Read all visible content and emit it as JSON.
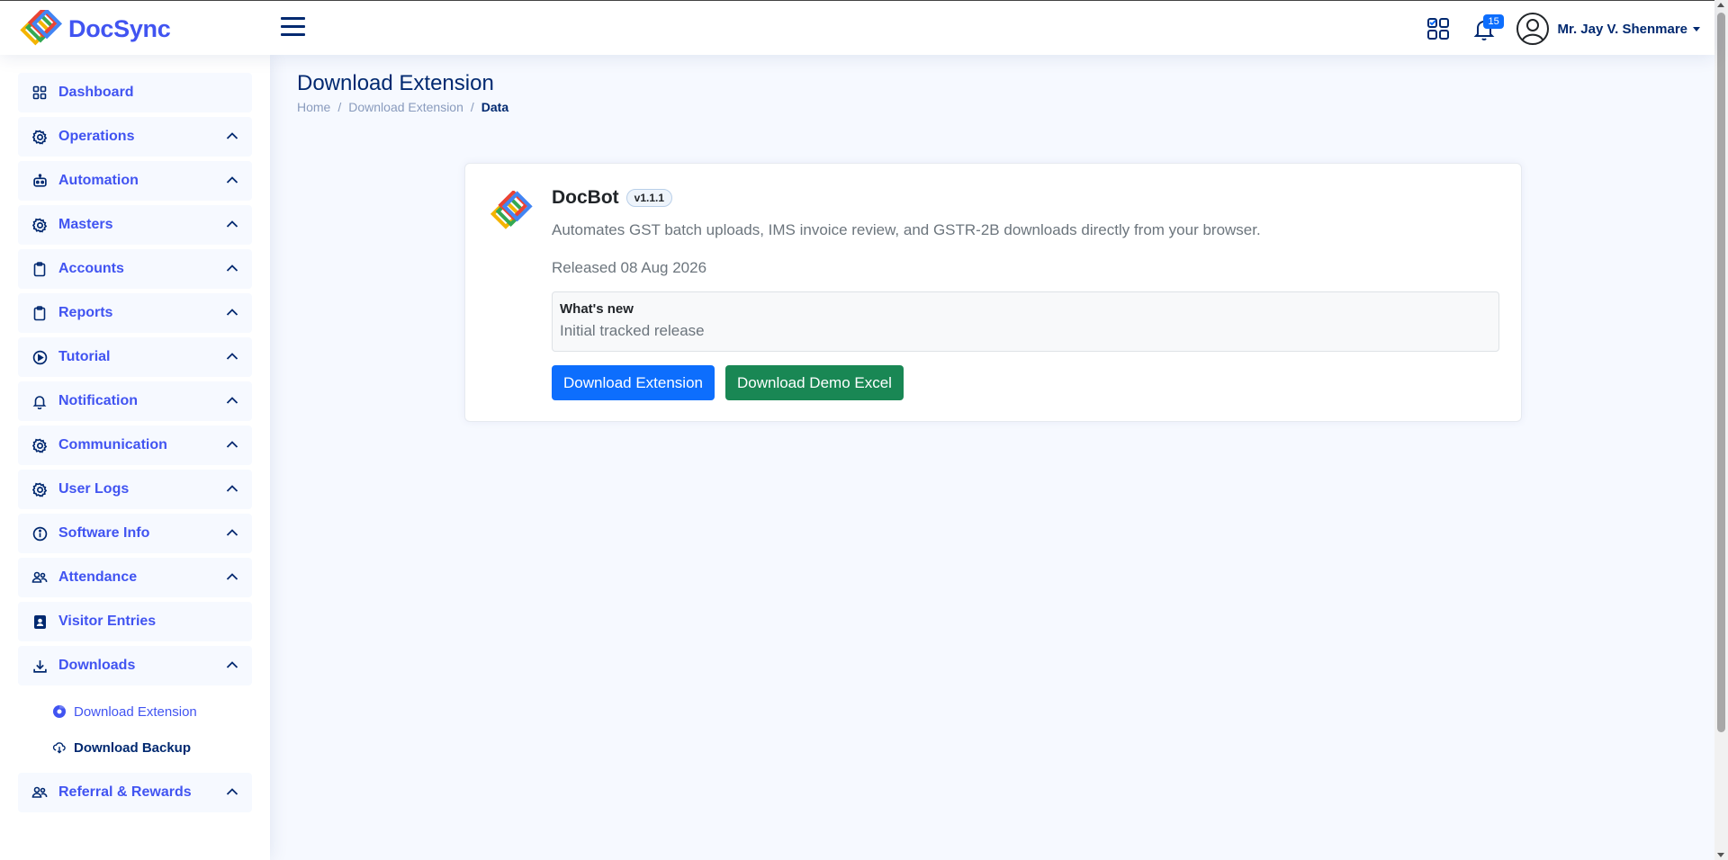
{
  "header": {
    "brand": "DocSync",
    "notification_count": "15",
    "user_name": "Mr. Jay V. Shenmare"
  },
  "sidebar": {
    "items": [
      {
        "label": "Dashboard",
        "icon": "grid-icon"
      },
      {
        "label": "Operations",
        "icon": "gear-icon"
      },
      {
        "label": "Automation",
        "icon": "robot-icon"
      },
      {
        "label": "Masters",
        "icon": "gear-icon"
      },
      {
        "label": "Accounts",
        "icon": "clipboard-icon"
      },
      {
        "label": "Reports",
        "icon": "clipboard-icon"
      },
      {
        "label": "Tutorial",
        "icon": "play-circle-icon"
      },
      {
        "label": "Notification",
        "icon": "bell-icon"
      },
      {
        "label": "Communication",
        "icon": "gear-icon"
      },
      {
        "label": "User Logs",
        "icon": "gear-icon"
      },
      {
        "label": "Software Info",
        "icon": "info-circle-icon"
      },
      {
        "label": "Attendance",
        "icon": "people-icon"
      },
      {
        "label": "Visitor Entries",
        "icon": "badge-icon"
      },
      {
        "label": "Downloads",
        "icon": "download-icon"
      }
    ],
    "downloads_sub": [
      {
        "label": "Download Extension",
        "icon": "browser-icon"
      },
      {
        "label": "Download Backup",
        "icon": "cloud-download-icon"
      }
    ],
    "last_item": {
      "label": "Referral & Rewards",
      "icon": "people-icon"
    }
  },
  "page": {
    "title": "Download Extension",
    "breadcrumb": [
      "Home",
      "Download Extension",
      "Data"
    ]
  },
  "extension": {
    "name": "DocBot",
    "version": "v1.1.1",
    "description": "Automates GST batch uploads, IMS invoice review, and GSTR-2B downloads directly from your browser.",
    "released": "Released 08 Aug 2026",
    "whats_new_title": "What's new",
    "whats_new_text": "Initial tracked release",
    "download_button": "Download Extension",
    "demo_button": "Download Demo Excel"
  },
  "colors": {
    "accent": "#4154f1",
    "navy": "#012970",
    "primary_button": "#0d6efd",
    "success_button": "#198754"
  }
}
